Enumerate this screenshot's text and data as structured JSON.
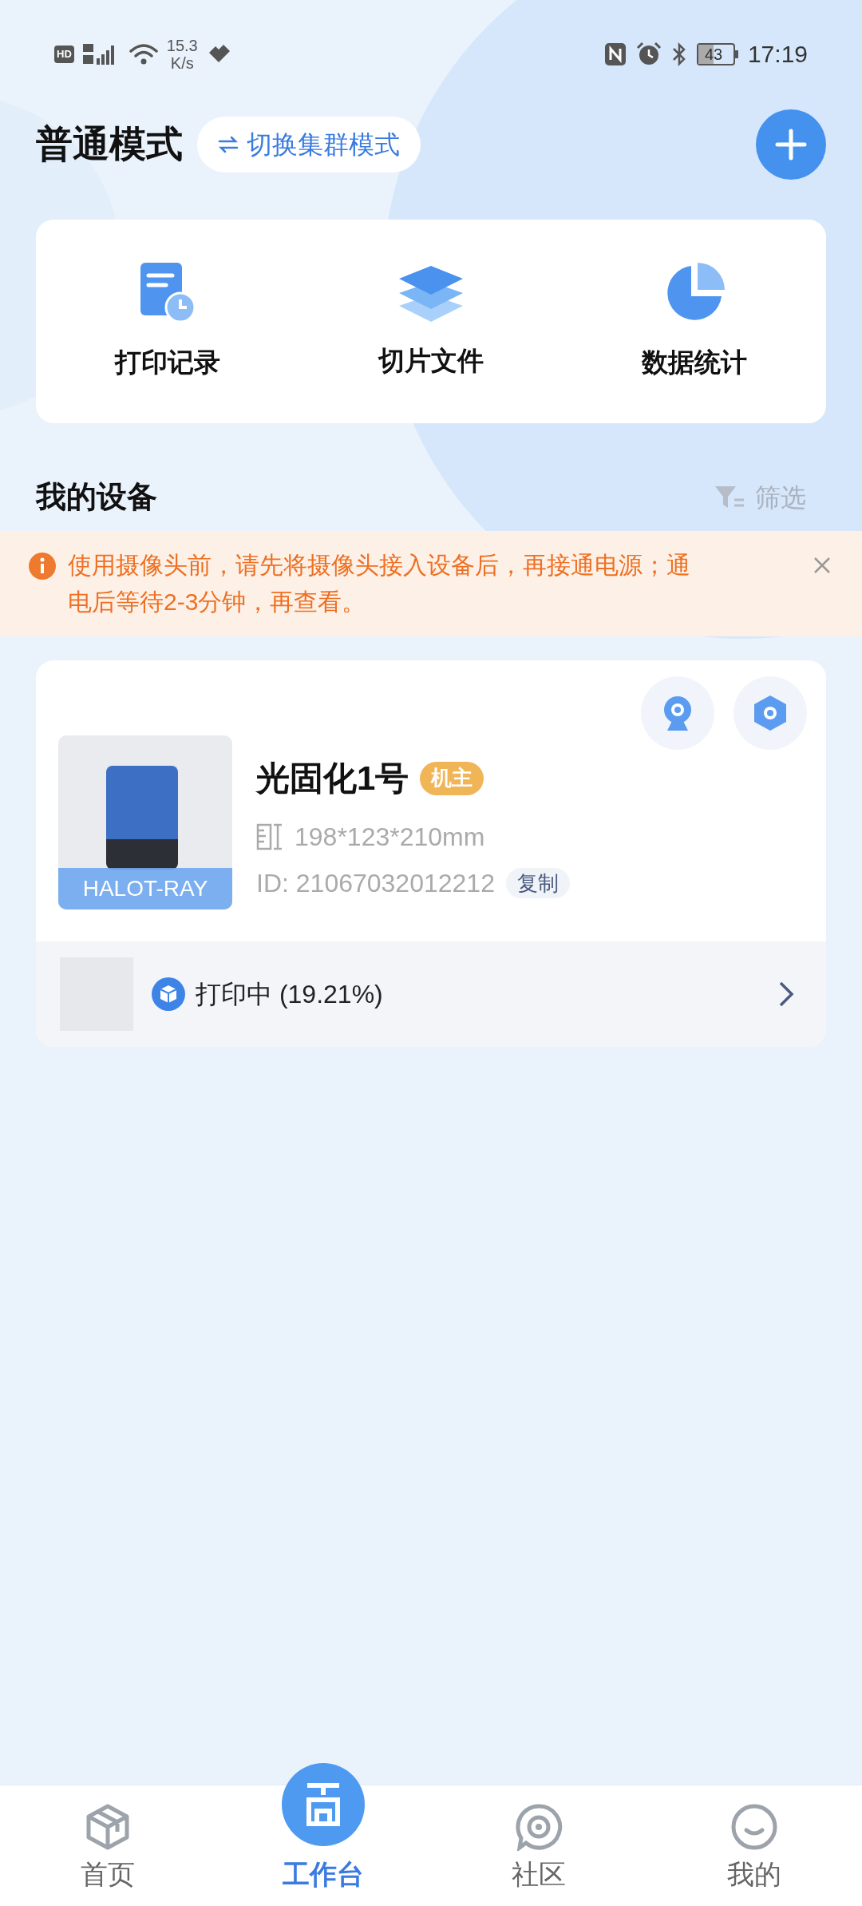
{
  "status_bar": {
    "hd_label": "HD",
    "speed": "15.3",
    "speed_unit": "K/s",
    "battery": "43",
    "time": "17:19"
  },
  "header": {
    "title": "普通模式",
    "mode_switch": "切换集群模式"
  },
  "quick_actions": [
    {
      "label": "打印记录"
    },
    {
      "label": "切片文件"
    },
    {
      "label": "数据统计"
    }
  ],
  "section": {
    "title": "我的设备",
    "filter": "筛选"
  },
  "notice": {
    "text": "使用摄像头前，请先将摄像头接入设备后，再接通电源；通电后等待2-3分钟，再查看。"
  },
  "device": {
    "model_label": "HALOT-RAY",
    "name": "光固化1号",
    "role": "机主",
    "dimensions": "198*123*210mm",
    "id": "ID: 21067032012212",
    "copy": "复制",
    "status": "打印中 (19.21%)"
  },
  "bottom_nav": [
    {
      "label": "首页",
      "selected": false
    },
    {
      "label": "工作台",
      "selected": true
    },
    {
      "label": "社区",
      "selected": false
    },
    {
      "label": "我的",
      "selected": false
    }
  ]
}
